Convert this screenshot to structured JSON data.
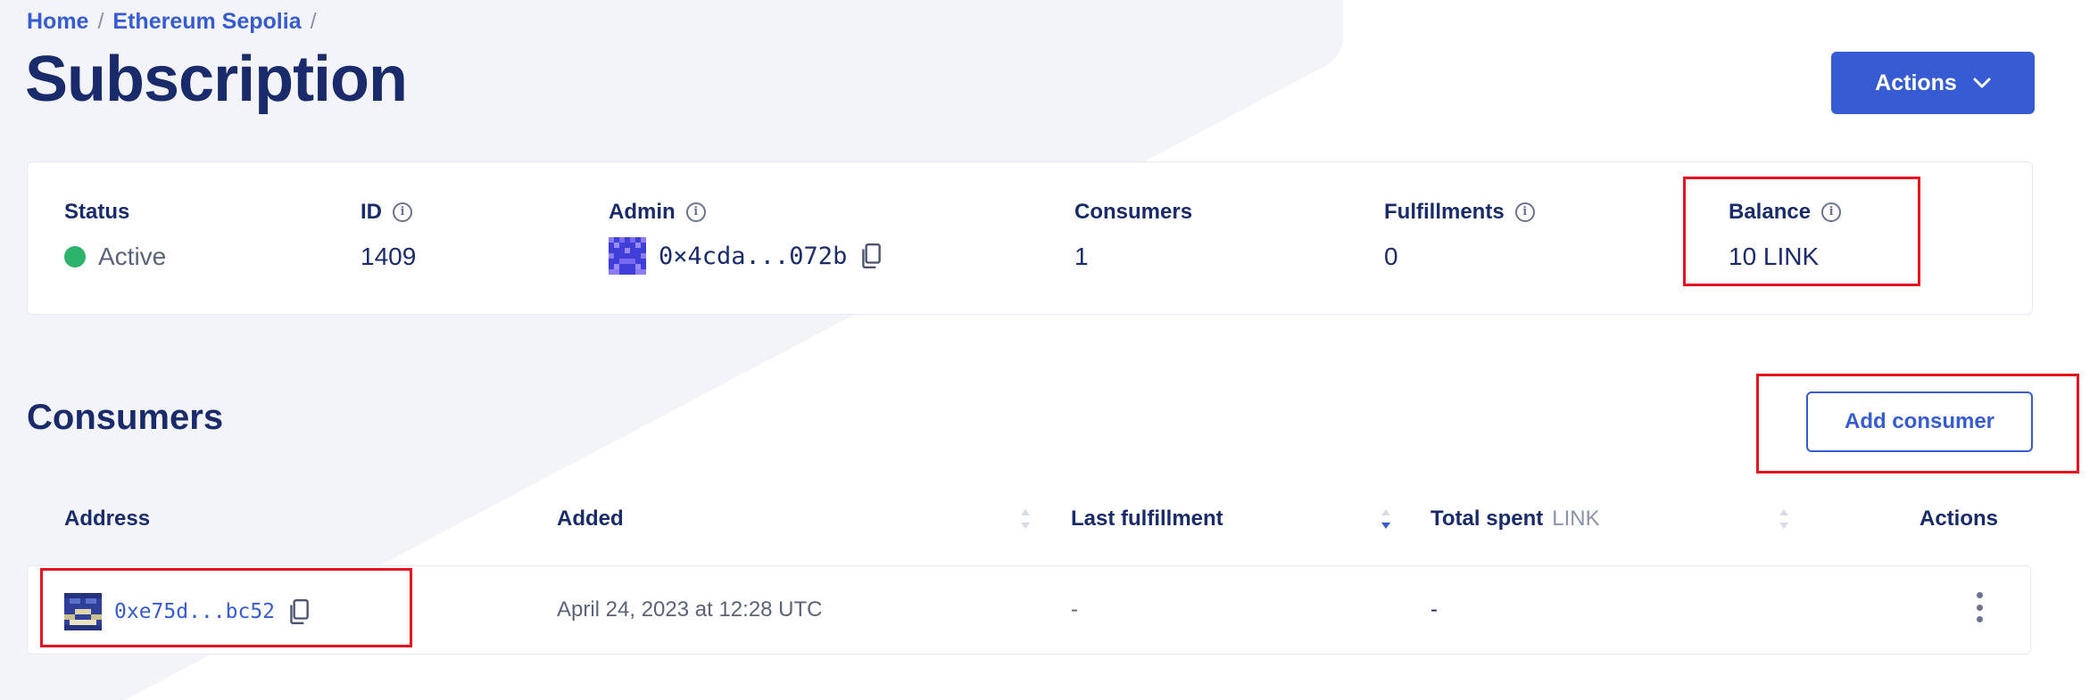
{
  "breadcrumb": {
    "home": "Home",
    "network": "Ethereum Sepolia",
    "separator": "/"
  },
  "page_title": "Subscription",
  "actions_button": {
    "label": "Actions",
    "icon": "chevron-down-icon"
  },
  "summary": {
    "status": {
      "label": "Status",
      "value": "Active",
      "color": "#2db36a"
    },
    "id": {
      "label": "ID",
      "value": "1409"
    },
    "admin": {
      "label": "Admin",
      "value": "0×4cda...072b"
    },
    "consumers": {
      "label": "Consumers",
      "value": "1"
    },
    "fulfillments": {
      "label": "Fulfillments",
      "value": "0"
    },
    "balance": {
      "label": "Balance",
      "value": "10 LINK"
    }
  },
  "consumers_section": {
    "title": "Consumers",
    "add_button": "Add consumer",
    "columns": {
      "address": "Address",
      "added": "Added",
      "last_fulfillment": "Last fulfillment",
      "total_spent": "Total spent",
      "total_spent_unit": "LINK",
      "actions": "Actions"
    },
    "rows": [
      {
        "address": "0xe75d...bc52",
        "added": "April 24, 2023 at 12:28 UTC",
        "last_fulfillment": "-",
        "total_spent": "-"
      }
    ]
  },
  "colors": {
    "accent": "#375bd2",
    "text": "#1a2b6b",
    "highlight": "#e4131f",
    "background_shape": "#f3f4f9"
  },
  "info_glyph": "i"
}
